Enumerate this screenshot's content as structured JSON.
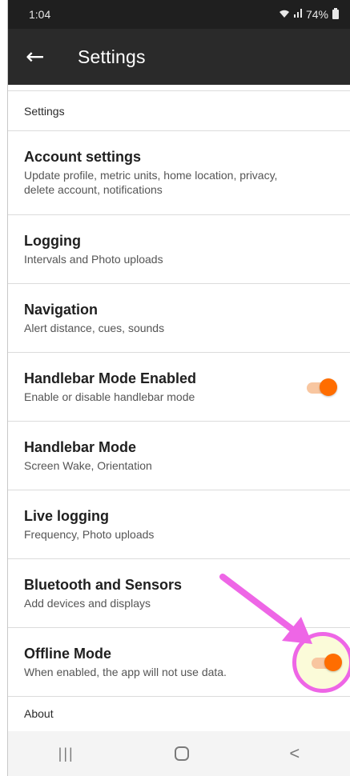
{
  "status_bar": {
    "time": "1:04",
    "battery": "74%"
  },
  "app_bar": {
    "title": "Settings"
  },
  "section_header": "Settings",
  "rows": [
    {
      "title": "Account settings",
      "subtitle": "Update profile, metric units, home location, privacy, delete account, notifications"
    },
    {
      "title": "Logging",
      "subtitle": "Intervals and Photo uploads"
    },
    {
      "title": "Navigation",
      "subtitle": "Alert distance, cues, sounds"
    },
    {
      "title": "Handlebar Mode Enabled",
      "subtitle": "Enable or disable handlebar mode",
      "toggle": true
    },
    {
      "title": "Handlebar Mode",
      "subtitle": "Screen Wake, Orientation"
    },
    {
      "title": "Live logging",
      "subtitle": "Frequency, Photo uploads"
    },
    {
      "title": "Bluetooth and Sensors",
      "subtitle": "Add devices and displays"
    },
    {
      "title": "Offline Mode",
      "subtitle": "When enabled, the app will not use data.",
      "toggle": true
    }
  ],
  "about_label": "About",
  "colors": {
    "accent": "#ff6d00",
    "annotation": "#ee66e6",
    "app_bar": "#2a2a2a"
  },
  "icons": {
    "back": "arrow-left-icon",
    "wifi": "wifi-icon",
    "signal": "signal-icon",
    "battery": "battery-icon"
  }
}
